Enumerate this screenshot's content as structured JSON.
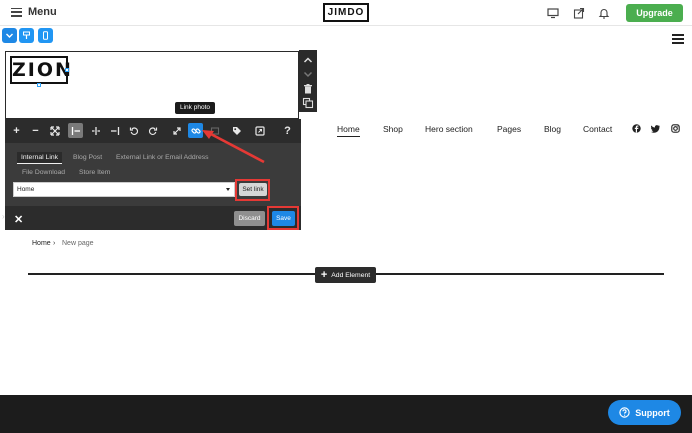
{
  "topbar": {
    "menu_label": "Menu",
    "logo": "JIMDO",
    "upgrade_label": "Upgrade",
    "icons": [
      "desktop-icon",
      "share-icon",
      "bell-icon"
    ]
  },
  "device_toggles": [
    "chevron-down-icon",
    "paintbrush-icon",
    "mobile-icon"
  ],
  "site": {
    "logo_text": "ZION",
    "nav": [
      "Home",
      "Shop",
      "Hero section",
      "Pages",
      "Blog",
      "Contact"
    ],
    "social_icons": [
      "facebook-icon",
      "twitter-icon",
      "instagram-icon"
    ]
  },
  "editor": {
    "tooltip": "Link photo",
    "tabs": {
      "internal": "Internal Link",
      "blog": "Blog Post",
      "external": "External Link or Email Address",
      "file": "File Download",
      "store": "Store Item"
    },
    "select_value": "Home",
    "set_link": "Set link",
    "discard": "Discard",
    "save": "Save"
  },
  "breadcrumb": {
    "home": "Home",
    "current": "New page"
  },
  "add_element": "Add Element",
  "support": "Support",
  "colors": {
    "accent_blue": "#1e88e5",
    "upgrade_green": "#4bae4f",
    "highlight_red": "#e53935",
    "toolbar_dark": "#2c2c2c"
  }
}
